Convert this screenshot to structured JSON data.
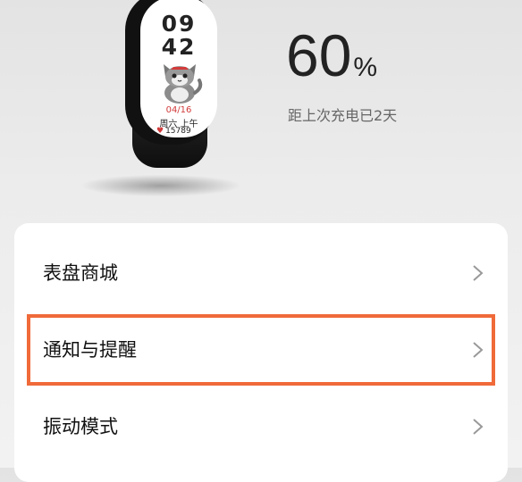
{
  "device": {
    "hour": "09",
    "minute": "42",
    "date": "04/16",
    "day": "周六 上午",
    "steps": "15789",
    "heart_icon": "heart-icon"
  },
  "battery": {
    "percent": "60",
    "unit": "%",
    "since_charge": "距上次充电已2天"
  },
  "menu": {
    "items": [
      {
        "label": "表盘商城"
      },
      {
        "label": "通知与提醒",
        "highlighted": true
      },
      {
        "label": "振动模式"
      }
    ]
  },
  "colors": {
    "highlight": "#f06a3a",
    "date": "#d23a3a"
  }
}
